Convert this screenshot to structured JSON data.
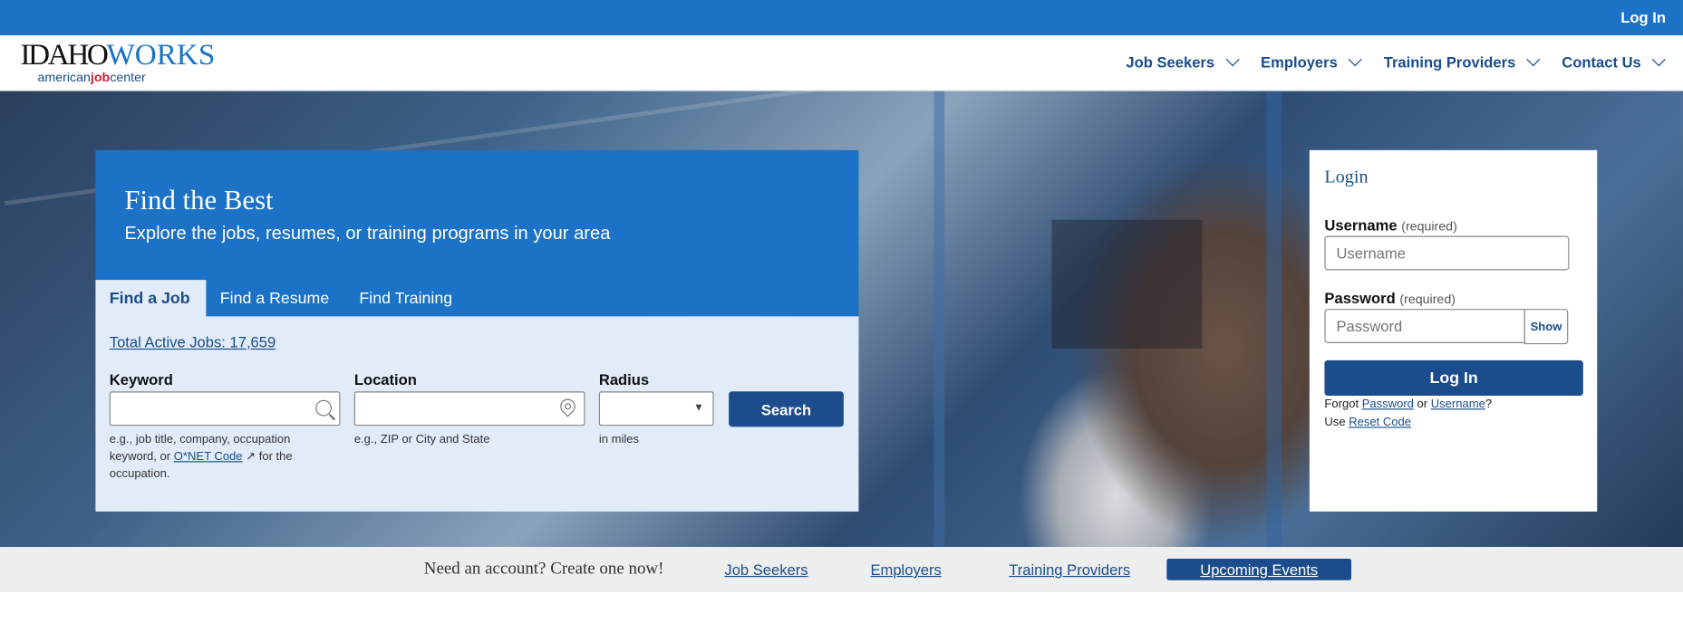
{
  "topbar": {
    "login": "Log In"
  },
  "logo": {
    "line1a": "IDAHO",
    "line1b": "WORKS",
    "line2a": "american",
    "line2b": "job",
    "line2c": "center"
  },
  "nav": [
    {
      "label": "Job Seekers"
    },
    {
      "label": "Employers"
    },
    {
      "label": "Training Providers"
    },
    {
      "label": "Contact Us"
    }
  ],
  "search": {
    "heading": "Find the Best",
    "subheading": "Explore the jobs, resumes, or training programs in your area",
    "tabs": [
      "Find a Job",
      "Find a Resume",
      "Find Training"
    ],
    "active_tab": "Find a Job",
    "total_jobs": "Total Active Jobs: 17,659",
    "keyword_label": "Keyword",
    "keyword_value": "",
    "keyword_help_1": "e.g., job title, company, occupation keyword, or",
    "keyword_help_link": "O*NET Code",
    "keyword_help_2": "for the occupation.",
    "location_label": "Location",
    "location_value": "",
    "location_help": "e.g., ZIP or City and State",
    "radius_label": "Radius",
    "radius_value": "",
    "radius_help": "in miles",
    "search_button": "Search"
  },
  "login": {
    "title": "Login",
    "username_label": "Username",
    "username_req": "(required)",
    "username_placeholder": "Username",
    "password_label": "Password",
    "password_req": "(required)",
    "password_placeholder": "Password",
    "show": "Show",
    "button": "Log In",
    "forgot": "Forgot",
    "forgot_password": "Password",
    "or": "or",
    "forgot_username": "Username",
    "qmark": "?",
    "use": "Use",
    "reset_code": "Reset Code"
  },
  "bottom": {
    "need": "Need an account? Create one now!",
    "links": [
      "Job Seekers",
      "Employers",
      "Training Providers"
    ],
    "events": "Upcoming Events"
  },
  "colors": {
    "primary": "#1b72c6",
    "dark": "#1b4d8c",
    "panel": "#e1ecf8"
  }
}
